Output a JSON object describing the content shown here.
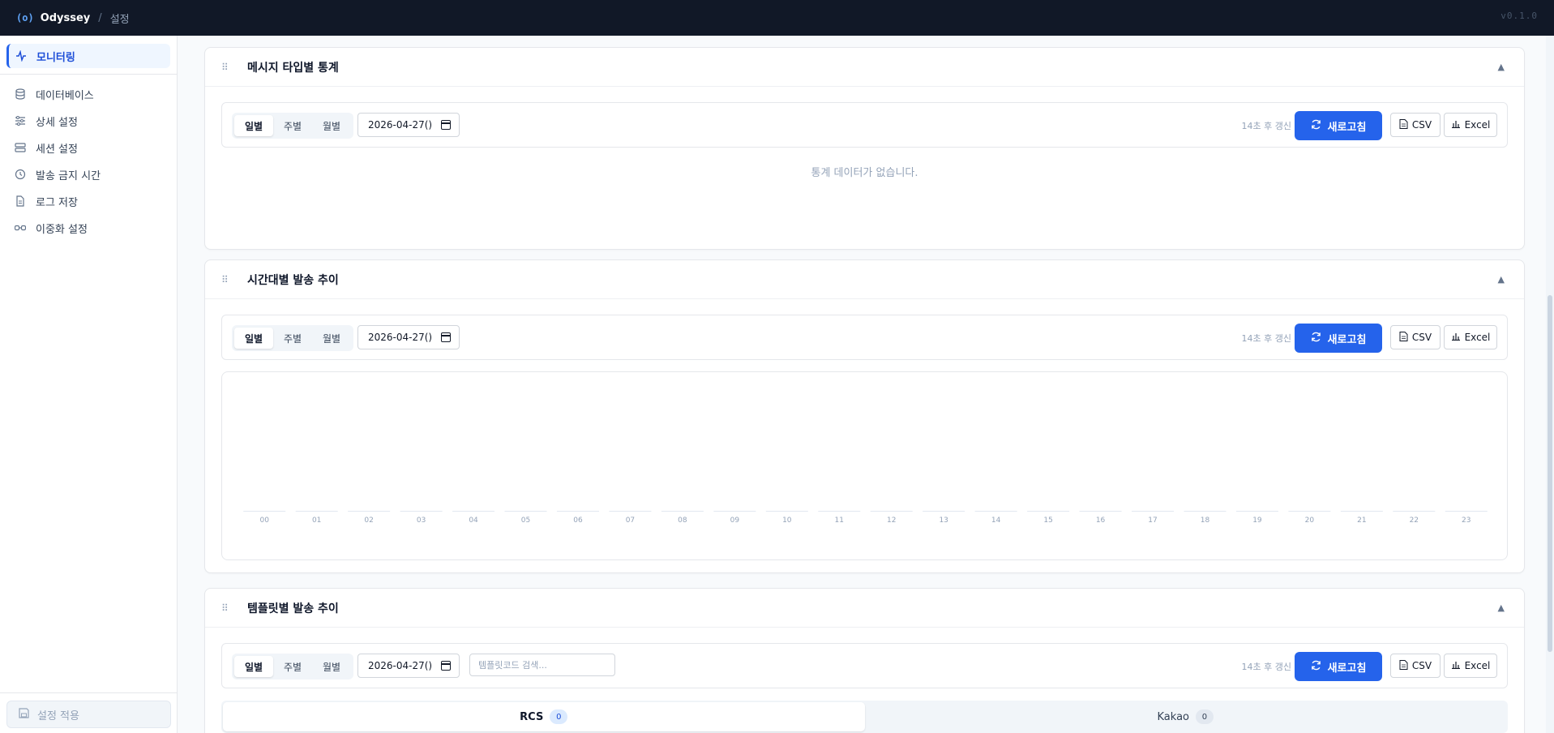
{
  "header": {
    "logo": "(o)",
    "brand": "Odyssey",
    "separator": "/",
    "crumb": "설정",
    "version": "v0.1.0"
  },
  "sidebar": {
    "items": [
      {
        "label": "모니터링",
        "icon": "activity-icon",
        "active": true
      },
      {
        "label": "데이터베이스",
        "icon": "database-icon"
      },
      {
        "label": "상세 설정",
        "icon": "sliders-icon"
      },
      {
        "label": "세션 설정",
        "icon": "server-icon"
      },
      {
        "label": "발송 금지 시간",
        "icon": "clock-icon"
      },
      {
        "label": "로그 저장",
        "icon": "file-text-icon"
      },
      {
        "label": "이중화 설정",
        "icon": "link-icon"
      }
    ],
    "apply_label": "설정 적용"
  },
  "sections": [
    {
      "title": "메시지 타입별 통계",
      "period_tabs": [
        "일별",
        "주별",
        "월별"
      ],
      "selected_period": "일별",
      "date_value": "2026-04-27()",
      "refresh_note": "14초 후 갱신",
      "refresh_label": "새로고침",
      "csv_label": "CSV",
      "excel_label": "Excel",
      "empty_message": "통계 데이터가 없습니다."
    },
    {
      "title": "시간대별 발송 추이",
      "period_tabs": [
        "일별",
        "주별",
        "월별"
      ],
      "selected_period": "일별",
      "date_value": "2026-04-27()",
      "refresh_note": "14초 후 갱신",
      "refresh_label": "새로고침",
      "csv_label": "CSV",
      "excel_label": "Excel"
    },
    {
      "title": "템플릿별 발송 추이",
      "period_tabs": [
        "일별",
        "주별",
        "월별"
      ],
      "selected_period": "일별",
      "date_value": "2026-04-27()",
      "search_placeholder": "템플릿코드 검색...",
      "refresh_note": "14초 후 갱신",
      "refresh_label": "새로고침",
      "csv_label": "CSV",
      "excel_label": "Excel",
      "channel_tabs": [
        {
          "label": "RCS",
          "count": "0",
          "active": true
        },
        {
          "label": "Kakao",
          "count": "0",
          "active": false
        }
      ]
    }
  ],
  "chart_data": {
    "type": "bar",
    "categories": [
      "00",
      "01",
      "02",
      "03",
      "04",
      "05",
      "06",
      "07",
      "08",
      "09",
      "10",
      "11",
      "12",
      "13",
      "14",
      "15",
      "16",
      "17",
      "18",
      "19",
      "20",
      "21",
      "22",
      "23"
    ],
    "values": [
      0,
      0,
      0,
      0,
      0,
      0,
      0,
      0,
      0,
      0,
      0,
      0,
      0,
      0,
      0,
      0,
      0,
      0,
      0,
      0,
      0,
      0,
      0,
      0
    ],
    "title": "",
    "xlabel": "",
    "ylabel": ""
  },
  "colors": {
    "accent": "#2563eb",
    "topbar": "#111827"
  }
}
